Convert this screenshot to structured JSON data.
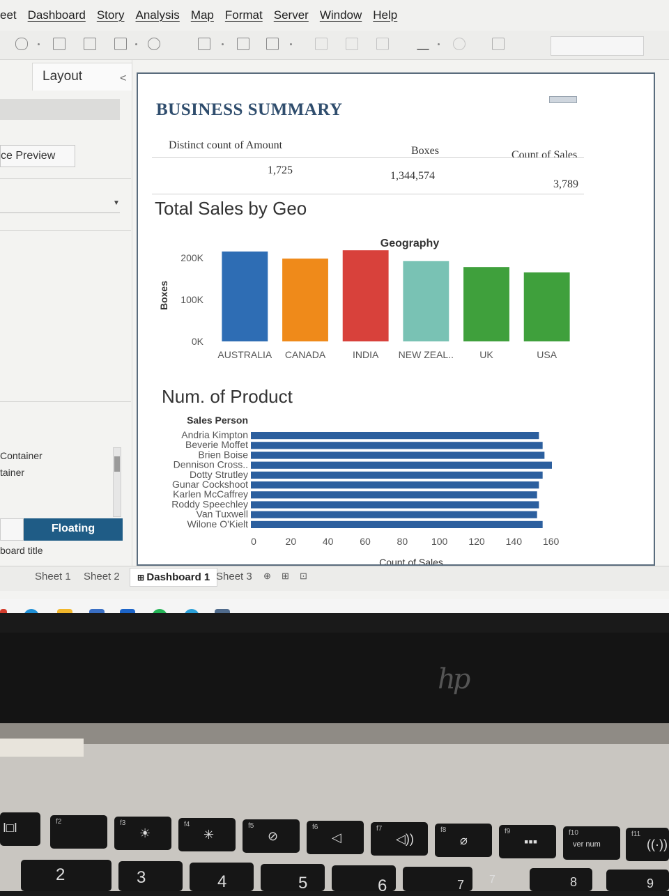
{
  "menu": [
    "eet",
    "Dashboard",
    "Story",
    "Analysis",
    "Map",
    "Format",
    "Server",
    "Window",
    "Help"
  ],
  "left_pane": {
    "layout_tab": "Layout",
    "preview_button": "ce Preview",
    "container_item": "Container",
    "tainer_item": "tainer",
    "floating_button": "Floating",
    "board_title_item": "board title"
  },
  "dashboard": {
    "title": "BUSINESS SUMMARY",
    "kpi": {
      "headers": [
        "Distinct count of Amount",
        "Boxes",
        "Count of Sales"
      ],
      "values": [
        "1,725",
        "1,344,574",
        "3,789"
      ]
    }
  },
  "chart_data": [
    {
      "type": "bar",
      "title": "Total Sales by Geo",
      "column_header": "Geography",
      "categories": [
        "AUSTRALIA",
        "CANADA",
        "INDIA",
        "NEW ZEAL..",
        "UK",
        "USA"
      ],
      "values": [
        215000,
        198000,
        218000,
        192000,
        178000,
        165000
      ],
      "colors": [
        "#2e6db4",
        "#ef8a1a",
        "#d8413b",
        "#79c2b4",
        "#3fa03c",
        "#3fa03c"
      ],
      "xlabel": "",
      "ylabel": "Boxes",
      "ylim": [
        0,
        220000
      ],
      "yticks": [
        "0K",
        "100K",
        "200K"
      ]
    },
    {
      "type": "bar",
      "orientation": "horizontal",
      "title": "Num. of Product",
      "row_header": "Sales Person",
      "categories": [
        "Andria Kimpton",
        "Beverie Moffet",
        "Brien Boise",
        "Dennison Cross..",
        "Dotty Strutley",
        "Gunar Cockshoot",
        "Karlen McCaffrey",
        "Roddy Speechley",
        "Van Tuxwell",
        "Wilone O'Kielt"
      ],
      "values": [
        155,
        157,
        158,
        162,
        157,
        155,
        154,
        155,
        154,
        157
      ],
      "color": "#2c5f9e",
      "xlabel": "Count of Sales",
      "xticks": [
        0,
        20,
        40,
        60,
        80,
        100,
        120,
        140,
        160
      ],
      "xlim": [
        0,
        165
      ]
    }
  ],
  "sheet_tabs": [
    "Sheet 1",
    "Sheet 2",
    "Dashboard 1",
    "Sheet 3"
  ],
  "keyboard": {
    "fkeys": [
      "f2",
      "f3",
      "f4",
      "f5",
      "f6",
      "f7",
      "f8",
      "f9",
      "f10",
      "f11"
    ],
    "fkey_text": "ver num",
    "numbers": [
      "2",
      "3",
      "4",
      "5",
      "6",
      "7",
      "7",
      "8",
      "9"
    ]
  },
  "colors": {
    "accent": "#1f5c86",
    "title": "#2f4d6d"
  }
}
